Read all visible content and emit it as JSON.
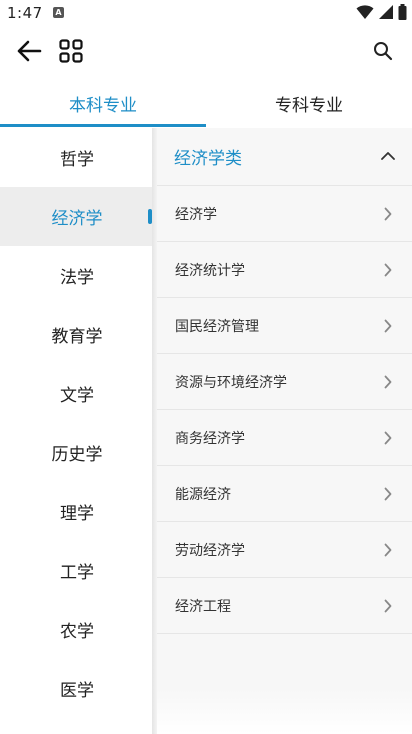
{
  "status_bar": {
    "time": "1:47",
    "app_icon_letter": "A",
    "icons": [
      "wifi-icon",
      "signal-icon",
      "battery-icon"
    ]
  },
  "app_bar": {
    "icons": [
      "back-arrow-icon",
      "grid-icon",
      "search-icon"
    ]
  },
  "tabs": [
    {
      "label": "本科专业",
      "selected": true
    },
    {
      "label": "专科专业",
      "selected": false
    }
  ],
  "categories": [
    {
      "label": "哲学"
    },
    {
      "label": "经济学",
      "selected": true
    },
    {
      "label": "法学"
    },
    {
      "label": "教育学"
    },
    {
      "label": "文学"
    },
    {
      "label": "历史学"
    },
    {
      "label": "理学"
    },
    {
      "label": "工学"
    },
    {
      "label": "农学"
    },
    {
      "label": "医学"
    }
  ],
  "group": {
    "title": "经济学类",
    "expanded": true,
    "items": [
      {
        "label": "经济学"
      },
      {
        "label": "经济统计学"
      },
      {
        "label": "国民经济管理"
      },
      {
        "label": "资源与环境经济学"
      },
      {
        "label": "商务经济学"
      },
      {
        "label": "能源经济"
      },
      {
        "label": "劳动经济学"
      },
      {
        "label": "经济工程"
      }
    ]
  },
  "colors": {
    "accent": "#1e8ec7",
    "selected_row_bg": "#ededed",
    "panel_bg": "#f7f7f7"
  }
}
